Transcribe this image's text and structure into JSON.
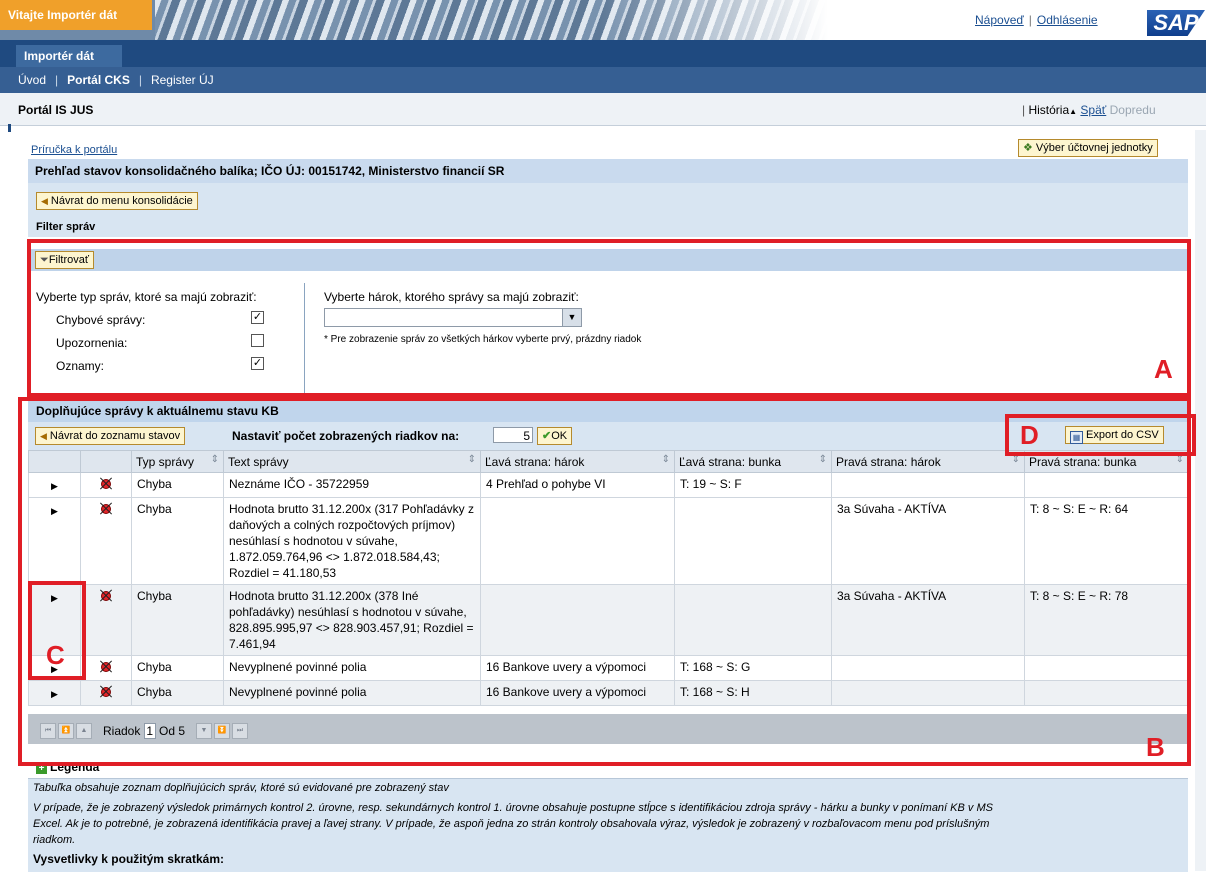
{
  "banner": {
    "welcome": "Vitajte Importér dát",
    "help_link": "Nápoveď",
    "logout_link": "Odhlásenie",
    "sap_logo": "SAP"
  },
  "nav": {
    "main_tab": "Importér dát",
    "sub_items": [
      "Úvod",
      "Portál CKS",
      "Register ÚJ"
    ]
  },
  "portal": {
    "title": "Portál IS JUS",
    "history": "História",
    "back": "Späť",
    "forward": "Dopredu"
  },
  "page": {
    "manual_link": "Príručka k portálu",
    "select_unit_button": "Výber účtovnej jednotky",
    "heading": "Prehľad stavov konsolidačného balíka; IČO ÚJ: 00151742, Ministerstvo financií SR",
    "back_menu_button": "Návrat do menu konsolidácie"
  },
  "filter": {
    "title": "Filter správ",
    "filter_button": "Filtrovať",
    "type_label": "Vyberte typ správ, ktoré sa majú zobraziť:",
    "types": [
      {
        "label": "Chybové správy:",
        "checked": true
      },
      {
        "label": "Upozornenia:",
        "checked": false
      },
      {
        "label": "Oznamy:",
        "checked": true
      }
    ],
    "sheet_label": "Vyberte hárok, ktorého správy sa majú zobraziť:",
    "sheet_value": "",
    "note": "* Pre zobrazenie správ zo všetkých hárkov vyberte prvý, prázdny riadok"
  },
  "messages": {
    "title": "Doplňujúce správy k aktuálnemu stavu KB",
    "back_list_button": "Návrat do zoznamu stavov",
    "rows_label": "Nastaviť počet zobrazených riadkov na:",
    "rows_value": "5",
    "ok_button": "OK",
    "export_button": "Export do CSV",
    "columns": [
      "Typ správy",
      "Text správy",
      "Ľavá strana: hárok",
      "Ľavá strana: bunka",
      "Pravá strana: hárok",
      "Pravá strana: bunka"
    ],
    "rows": [
      {
        "type": "Chyba",
        "text": "Neznáme IČO - 35722959",
        "left_sheet": "4 Prehľad o pohybe VI",
        "left_cell": "T: 19 ~ S: F",
        "right_sheet": "",
        "right_cell": ""
      },
      {
        "type": "Chyba",
        "text": "Hodnota brutto 31.12.200x (317 Pohľadávky z daňových a colných rozpočtových príjmov) nesúhlasí s hodnotou v súvahe, 1.872.059.764,96 <> 1.872.018.584,43; Rozdiel = 41.180,53",
        "left_sheet": "",
        "left_cell": "",
        "right_sheet": "3a Súvaha - AKTÍVA",
        "right_cell": "T: 8 ~ S: E ~ R: 64"
      },
      {
        "type": "Chyba",
        "text": "Hodnota brutto 31.12.200x (378 Iné pohľadávky) nesúhlasí s hodnotou v súvahe, 828.895.995,97 <> 828.903.457,91; Rozdiel = 7.461,94",
        "left_sheet": "",
        "left_cell": "",
        "right_sheet": "3a Súvaha - AKTÍVA",
        "right_cell": "T: 8 ~ S: E ~ R: 78"
      },
      {
        "type": "Chyba",
        "text": "Nevyplnené povinné polia",
        "left_sheet": "16 Bankove uvery a výpomoci",
        "left_cell": "T: 168 ~ S: G",
        "right_sheet": "",
        "right_cell": ""
      },
      {
        "type": "Chyba",
        "text": "Nevyplnené povinné polia",
        "left_sheet": "16 Bankove uvery a výpomoci",
        "left_cell": "T: 168 ~ S: H",
        "right_sheet": "",
        "right_cell": ""
      }
    ],
    "pager": {
      "row_label": "Riadok",
      "current": "1",
      "of_label": "Od 5"
    }
  },
  "legend": {
    "title": "Legenda",
    "line1": "Tabuľka obsahuje zoznam doplňujúcich správ, ktoré sú evidované pre zobrazený stav",
    "line2": "V prípade, že je zobrazený výsledok primárnych kontrol 2. úrovne, resp. sekundárnych kontrol 1. úrovne obsahuje postupne stĺpce s identifikáciou zdroja správy - hárku a bunky v ponímaní KB v MS",
    "line3": "Excel. Ak je to potrebné, je zobrazená identifikácia pravej a ľavej strany. V prípade, že aspoň jedna zo strán kontroly obsahovala výraz, výsledok je zobrazený v rozbaľovacom menu pod príslušným",
    "line4": "riadkom.",
    "abbr_title": "Vysvetlivky k použitým skratkám:"
  },
  "annotations": {
    "a": "A",
    "b": "B",
    "c": "C",
    "d": "D"
  },
  "colors": {
    "annotation_red": "#e01e26",
    "nav_blue": "#1f4a80",
    "welcome_orange": "#f0a02a"
  }
}
